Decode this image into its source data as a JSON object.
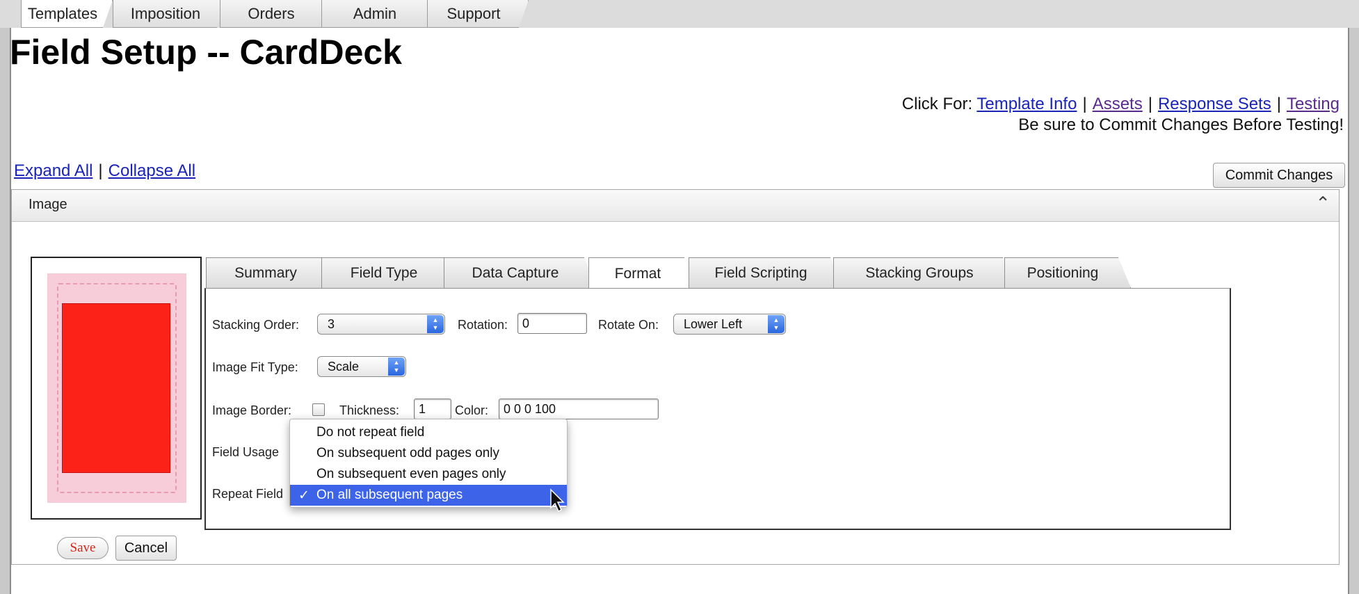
{
  "top_tabs": [
    {
      "label": "Templates",
      "active": true
    },
    {
      "label": "Imposition",
      "active": false
    },
    {
      "label": "Orders",
      "active": false
    },
    {
      "label": "Admin",
      "active": false
    },
    {
      "label": "Support",
      "active": false
    }
  ],
  "page": {
    "title": "Field Setup -- CardDeck",
    "click_for_label": "Click For:",
    "links": [
      "Template Info",
      "Assets",
      "Response Sets",
      "Testing"
    ],
    "separator": "|",
    "note": "Be sure to Commit Changes Before Testing!",
    "commit_button": "Commit Changes",
    "expand_all": "Expand All",
    "collapse_all": "Collapse All"
  },
  "panel": {
    "title": "Image",
    "tabs": [
      "Summary",
      "Field Type",
      "Data Capture",
      "Format",
      "Field Scripting",
      "Stacking Groups",
      "Positioning"
    ],
    "active_tab": "Format",
    "preview": {
      "card_color": "#f6cdd9",
      "image_color": "#fd2217"
    }
  },
  "format": {
    "stacking_order_label": "Stacking Order:",
    "stacking_order_value": "3",
    "rotation_label": "Rotation:",
    "rotation_value": "0",
    "rotate_on_label": "Rotate On:",
    "rotate_on_value": "Lower Left",
    "image_fit_label": "Image Fit Type:",
    "image_fit_value": "Scale",
    "image_border_label": "Image Border:",
    "image_border_checked": false,
    "thickness_label": "Thickness:",
    "thickness_value": "1",
    "color_label": "Color:",
    "color_value": "0 0 0 100",
    "field_usage_label": "Field Usage",
    "repeat_field_label": "Repeat Field"
  },
  "repeat_menu": {
    "options": [
      "Do not repeat field",
      "On subsequent odd pages only",
      "On subsequent even pages only",
      "On all subsequent pages"
    ],
    "selected": "On all subsequent pages",
    "check_mark": "✓"
  },
  "buttons": {
    "save": "Save",
    "cancel": "Cancel"
  },
  "colors": {
    "link": "#1a24b8",
    "visited_link": "#5a2a8c",
    "menu_highlight": "#3d64e8",
    "save_text": "#d3261c"
  }
}
